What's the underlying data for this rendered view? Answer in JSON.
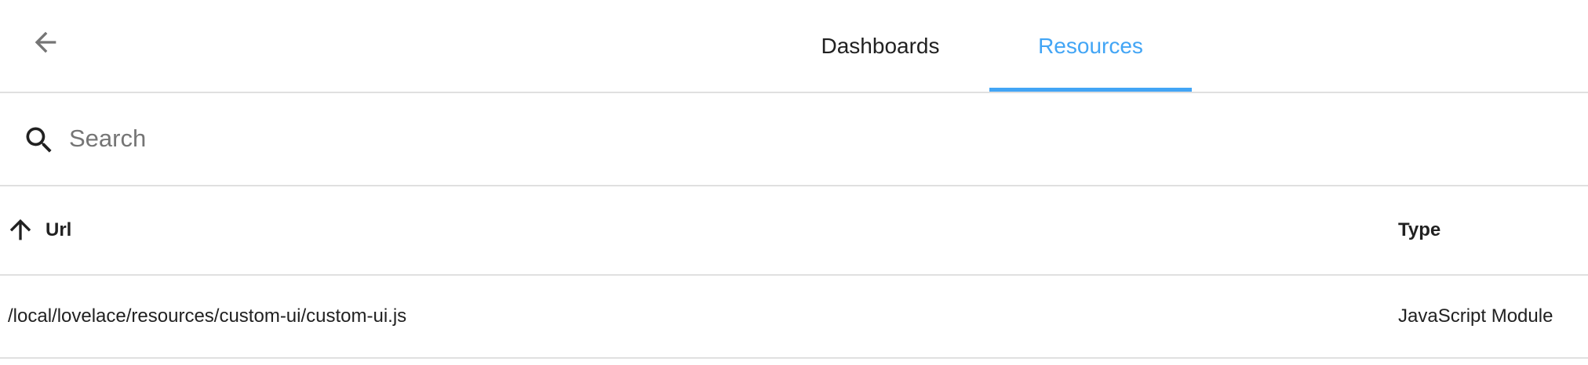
{
  "header": {
    "back_icon": "arrow-left-icon",
    "tabs": [
      {
        "label": "Dashboards",
        "active": false
      },
      {
        "label": "Resources",
        "active": true
      }
    ],
    "active_color": "#42a5f5"
  },
  "search": {
    "icon": "magnify-icon",
    "placeholder": "Search",
    "value": ""
  },
  "table": {
    "sort_icon": "arrow-up-icon",
    "columns": [
      "Url",
      "Type"
    ],
    "rows": [
      {
        "url": "/local/lovelace/resources/custom-ui/custom-ui.js",
        "type": "JavaScript Module"
      }
    ]
  }
}
